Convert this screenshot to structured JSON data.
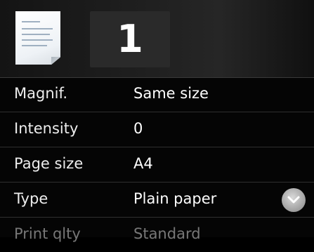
{
  "header": {
    "copies": "1"
  },
  "settings": [
    {
      "label": "Magnif.",
      "value": "Same size"
    },
    {
      "label": "Intensity",
      "value": "0"
    },
    {
      "label": "Page size",
      "value": "A4"
    },
    {
      "label": "Type",
      "value": "Plain paper"
    },
    {
      "label": "Print qlty",
      "value": "Standard"
    }
  ],
  "icons": {
    "document": "document-icon",
    "scroll": "chevron-down-icon"
  }
}
